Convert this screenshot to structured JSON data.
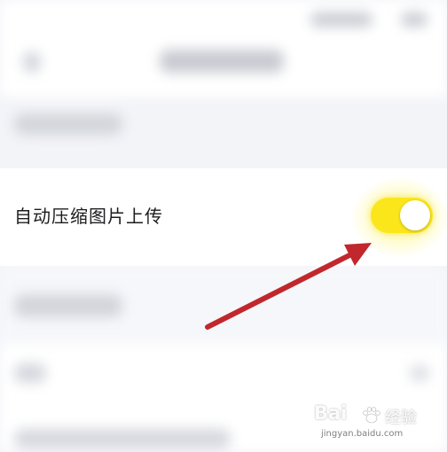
{
  "settings": {
    "auto_compress_label": "自动压缩图片上传",
    "auto_compress_enabled": true
  },
  "watermark": {
    "brand": "Bai",
    "brand_suffix": "经验",
    "url": "jingyan.baidu.com"
  },
  "colors": {
    "toggle_on": "#fbe61c",
    "arrow": "#c0282d",
    "background": "#f3f4f8"
  }
}
